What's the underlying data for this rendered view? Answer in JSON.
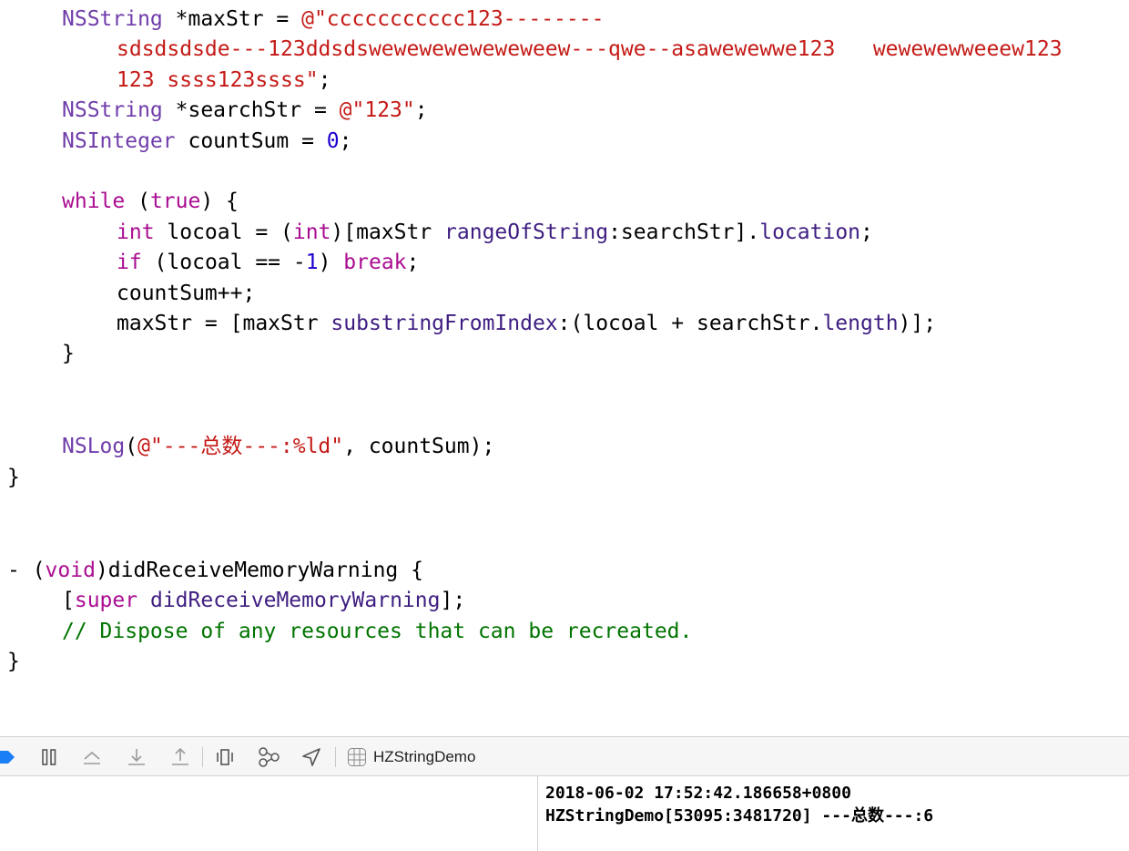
{
  "editor": {
    "lines": {
      "max_str_decl": {
        "type": "NSString",
        "var": " *maxStr = ",
        "str": "@\"ccccccccccc123--------"
      },
      "max_str_cont1": {
        "str": "sdsdsdsde---123ddsdsweweweweweweweew---qwe--asawewewwe123   wewewewweeew123"
      },
      "max_str_cont2": {
        "str": "123 ssss123ssss\"",
        "end": ";"
      },
      "search_str_decl": {
        "type": "NSString",
        "var": " *searchStr = ",
        "str": "@\"123\"",
        "end": ";"
      },
      "count_sum_decl": {
        "type": "NSInteger",
        "var": " countSum = ",
        "num": "0",
        "end": ";"
      },
      "while_line": {
        "kw": "while",
        "p1": " (",
        "kw2": "true",
        "p2": ") {"
      },
      "int_line": {
        "kw": "int",
        "p1": " locoal = (",
        "kw2": "int",
        "p2": ")[maxStr ",
        "m1": "rangeOfString",
        "p3": ":searchStr].",
        "m2": "location",
        "p4": ";"
      },
      "if_line": {
        "kw": "if",
        "p1": " (locoal == -",
        "num": "1",
        "p2": ") ",
        "kw2": "break",
        "p3": ";"
      },
      "count_inc": {
        "text": "countSum++;"
      },
      "substring_line": {
        "p1": "maxStr = [maxStr ",
        "m1": "substringFromIndex",
        "p2": ":(locoal + searchStr.",
        "m2": "length",
        "p3": ")];"
      },
      "close_while": {
        "text": "}"
      },
      "nslog_line": {
        "fn": "NSLog",
        "p1": "(",
        "str": "@\"---总数---:%ld\"",
        "p2": ", countSum);"
      },
      "close_method1": {
        "text": "}"
      },
      "memwarn_decl": {
        "p1": "- (",
        "kw": "void",
        "p2": ")didReceiveMemoryWarning {"
      },
      "super_call": {
        "p1": "[",
        "kw": "super",
        "sp": " ",
        "m1": "didReceiveMemoryWarning",
        "p2": "];"
      },
      "comment_line": {
        "text": "// Dispose of any resources that can be recreated."
      },
      "close_method2": {
        "text": "}"
      }
    }
  },
  "debug_bar": {
    "icons": [
      "breakpoints-toggle-icon",
      "pause-icon",
      "step-over-icon",
      "step-into-icon",
      "step-out-icon",
      "view-debugger-icon",
      "memory-graph-icon",
      "simulate-location-icon",
      "app-icon"
    ],
    "scheme_name": "HZStringDemo",
    "accent_color": "#1a7ef7"
  },
  "console": {
    "line1": "2018-06-02 17:52:42.186658+0800",
    "line2": "HZStringDemo[53095:3481720] ---总数---:6"
  }
}
